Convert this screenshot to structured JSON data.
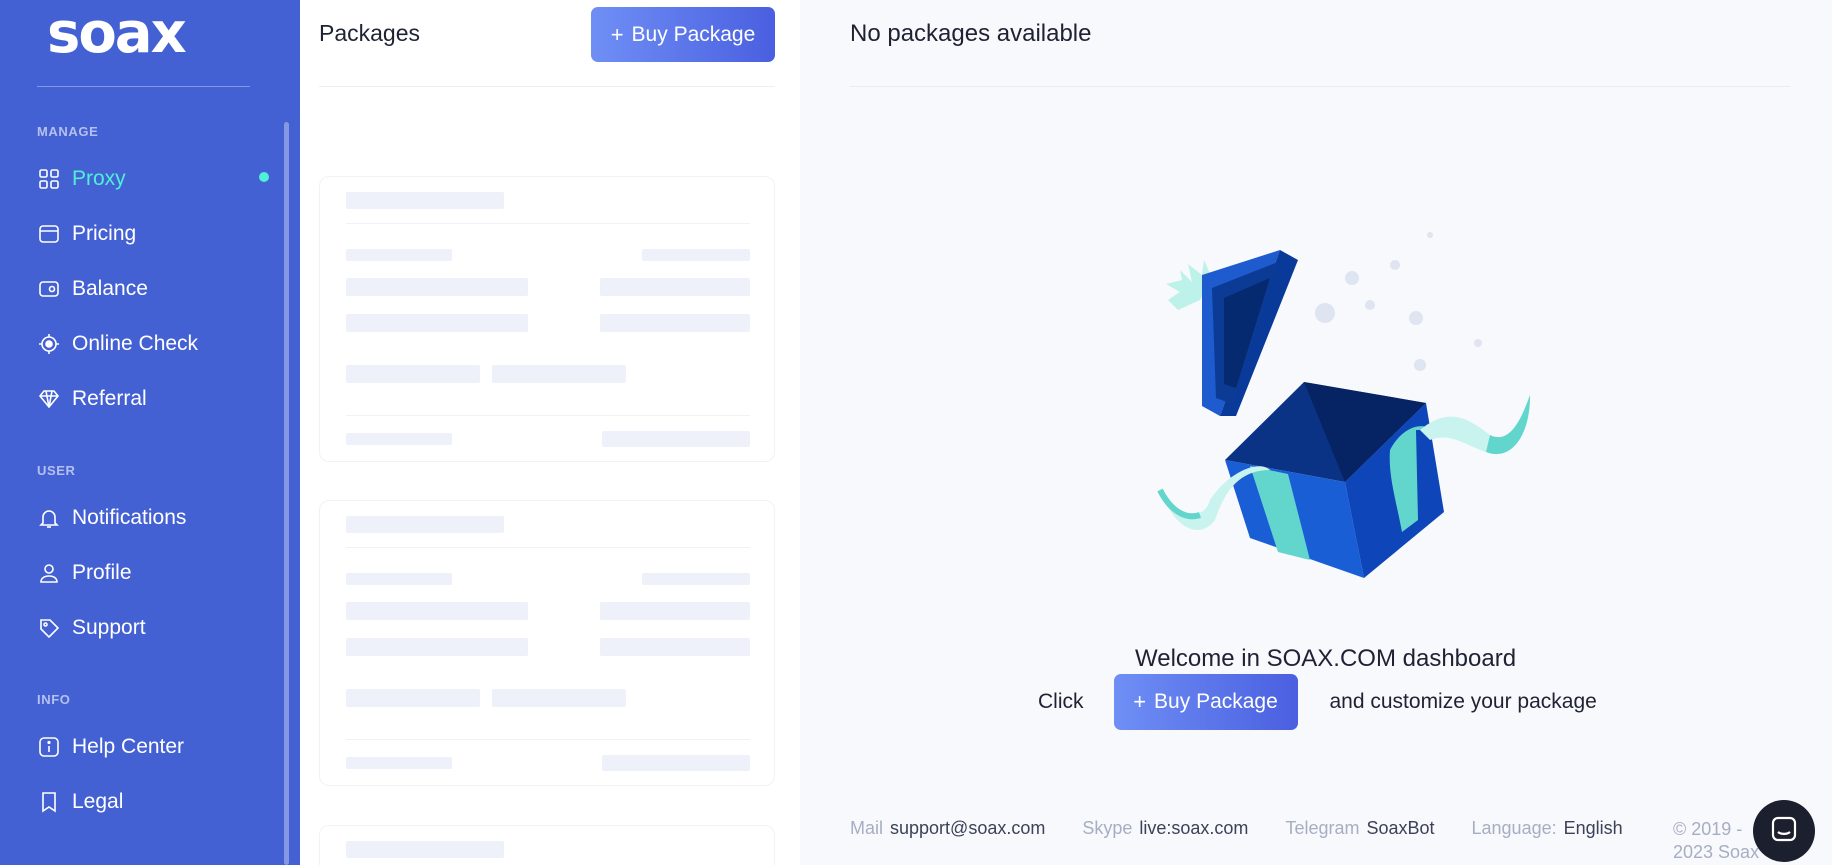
{
  "brand": {
    "logo": "soax",
    "accent": "#4ff0d6",
    "sidebar_bg": "#4461d4"
  },
  "sidebar": {
    "sections": {
      "manage": "MANAGE",
      "user": "USER",
      "info": "INFO"
    },
    "items": [
      {
        "label": "Proxy",
        "icon": "grid-icon",
        "active": true
      },
      {
        "label": "Pricing",
        "icon": "wallet-icon"
      },
      {
        "label": "Balance",
        "icon": "balance-icon"
      },
      {
        "label": "Online Check",
        "icon": "target-icon"
      },
      {
        "label": "Referral",
        "icon": "diamond-icon"
      },
      {
        "label": "Notifications",
        "icon": "bell-icon"
      },
      {
        "label": "Profile",
        "icon": "user-icon"
      },
      {
        "label": "Support",
        "icon": "tag-icon"
      },
      {
        "label": "Help Center",
        "icon": "info-icon"
      },
      {
        "label": "Legal",
        "icon": "bookmark-icon"
      }
    ]
  },
  "packages": {
    "title": "Packages",
    "buy_label": "Buy Package",
    "plus": "+"
  },
  "main": {
    "heading": "No packages available",
    "welcome": "Welcome in SOAX.COM dashboard",
    "click_text": "Click",
    "buy_label": "Buy Package",
    "plus": "+",
    "after_text": "and customize your package"
  },
  "footer": {
    "mail_label": "Mail",
    "mail": "support@soax.com",
    "skype_label": "Skype",
    "skype": "live:soax.com",
    "telegram_label": "Telegram",
    "telegram": "SoaxBot",
    "language_label": "Language:",
    "language": "English",
    "copyright": "© 2019 - 2023 Soax"
  }
}
